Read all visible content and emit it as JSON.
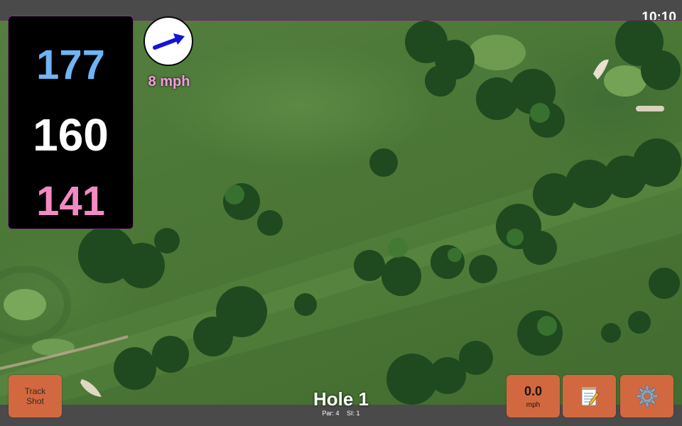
{
  "status": {
    "time": "10:10"
  },
  "yardages": {
    "back": "177",
    "middle": "160",
    "front": "141"
  },
  "wind": {
    "speed_label": "8 mph",
    "direction_icon": "wind-arrow-icon"
  },
  "buttons": {
    "track_shot_line1": "Track",
    "track_shot_line2": "Shot",
    "speed_value": "0.0",
    "speed_unit": "mph",
    "notes_icon": "notepad-icon",
    "settings_icon": "gear-icon"
  },
  "hole": {
    "title": "Hole 1",
    "par": "Par: 4",
    "si": "SI: 1"
  },
  "colors": {
    "back_yardage": "#6fb4f4",
    "middle_yardage": "#ffffff",
    "front_yardage": "#f28ac3",
    "wind_text": "#f59be0",
    "button_orange": "#d2683f"
  }
}
